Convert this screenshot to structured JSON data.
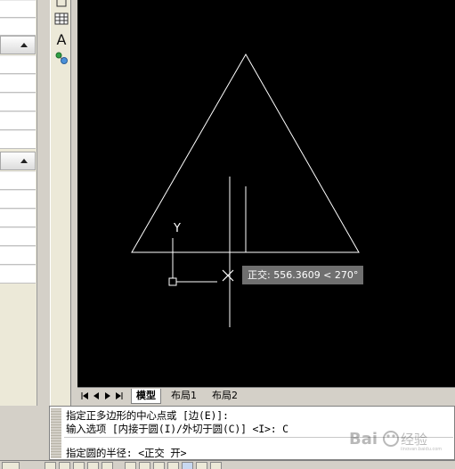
{
  "layout_tabs": [
    {
      "label": "模型",
      "active": true
    },
    {
      "label": "布局1",
      "active": false
    },
    {
      "label": "布局2",
      "active": false
    }
  ],
  "command": {
    "line1": "指定正多边形的中心点或 [边(E)]:",
    "line2": "输入选项 [内接于圆(I)/外切于圆(C)] <I>: C",
    "line3": "指定圆的半径:  <正交 开>"
  },
  "tooltip": "正交: 556.3609 < 270°",
  "ucs": {
    "y_label": "Y"
  },
  "watermark": {
    "text": "Bai 经验",
    "sub": "jingyan.baidu.com"
  },
  "tools": {
    "text_tool": "A"
  },
  "colors": {
    "canvas": "#000000",
    "lines": "#ffffff",
    "tooltip_bg": "#6f6f6f",
    "ui": "#d4d0c8"
  }
}
